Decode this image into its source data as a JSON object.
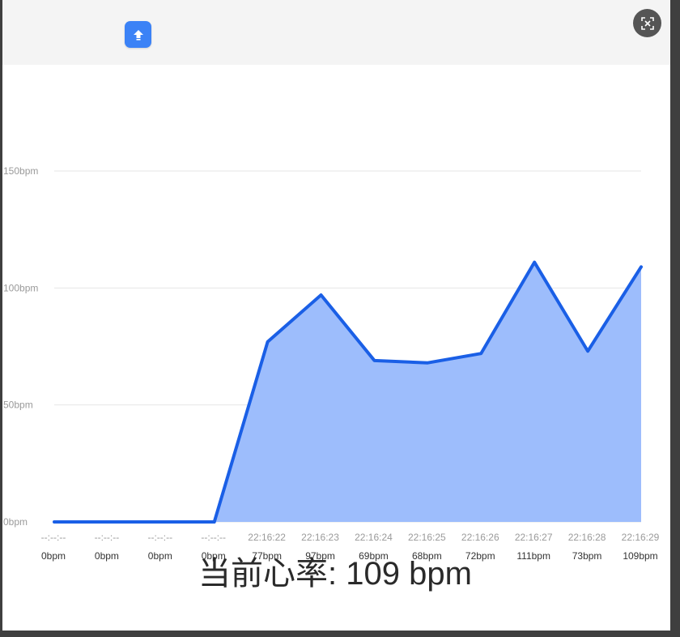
{
  "toolbar": {
    "upload_icon": "upload-arrow-icon",
    "close_icon": "close-x-icon",
    "accent_color": "#3b82f6"
  },
  "caption": {
    "text": "当前心率: 109 bpm"
  },
  "chart_data": {
    "type": "area",
    "times": [
      "--:--:--",
      "--:--:--",
      "--:--:--",
      "--:--:--",
      "22:16:22",
      "22:16:23",
      "22:16:24",
      "22:16:25",
      "22:16:26",
      "22:16:27",
      "22:16:28",
      "22:16:29"
    ],
    "value_labels": [
      "0bpm",
      "0bpm",
      "0bpm",
      "0bpm",
      "77bpm",
      "97bpm",
      "69bpm",
      "68bpm",
      "72bpm",
      "111bpm",
      "73bpm",
      "109bpm"
    ],
    "values": [
      0,
      0,
      0,
      0,
      77,
      97,
      69,
      68,
      72,
      111,
      73,
      109
    ],
    "y_ticks": [
      0,
      50,
      100,
      150
    ],
    "y_tick_labels": [
      "0bpm",
      "50bpm",
      "100bpm",
      "150bpm"
    ],
    "ylim": [
      0,
      150
    ],
    "grid": true,
    "line_color": "#1a5fe6",
    "fill_color": "#9dbdfc"
  }
}
